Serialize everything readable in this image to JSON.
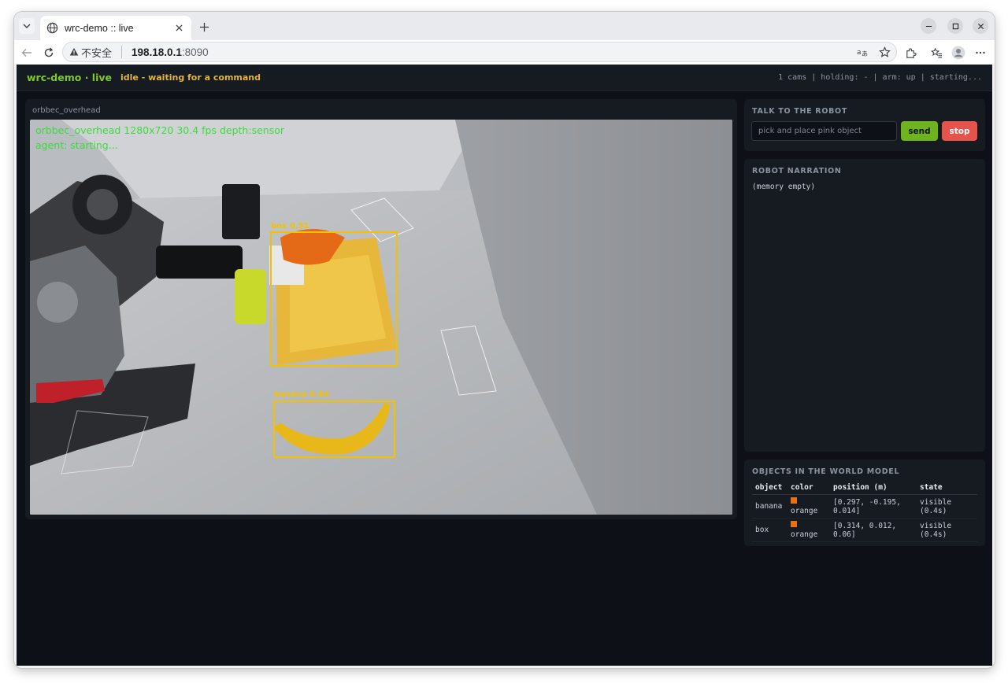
{
  "browser": {
    "tab_title": "wrc-demo :: live",
    "insecure_label": "不安全",
    "url_host": "198.18.0.1",
    "url_port": ":8090"
  },
  "header": {
    "brand": "wrc-demo · live",
    "status": "idle - waiting for a command",
    "meta": "1 cams | holding: - | arm: up | starting..."
  },
  "camera": {
    "name": "orbbec_overhead",
    "overlay_line1": "orbbec_overhead 1280x720 30.4 fps depth:sensor",
    "overlay_line2": "agent: starting...",
    "detections": [
      {
        "label": "box 0.51"
      },
      {
        "label": "banana 0.84"
      }
    ]
  },
  "talk": {
    "title": "TALK TO THE ROBOT",
    "placeholder": "pick and place pink object",
    "send_label": "send",
    "stop_label": "stop"
  },
  "narration": {
    "title": "ROBOT NARRATION",
    "text": "(memory empty)"
  },
  "objects": {
    "title": "OBJECTS IN THE WORLD MODEL",
    "headers": {
      "object": "object",
      "color": "color",
      "position": "position (m)",
      "state": "state"
    },
    "rows": [
      {
        "object": "banana",
        "color": "orange",
        "swatch": "#e8730c",
        "position": "[0.297, -0.195, 0.014]",
        "state": "visible (0.4s)"
      },
      {
        "object": "box",
        "color": "orange",
        "swatch": "#e8730c",
        "position": "[0.314, 0.012, 0.06]",
        "state": "visible (0.4s)"
      }
    ]
  },
  "colors": {
    "accent_green": "#7ec92f",
    "status_yellow": "#e3b341",
    "stop_red": "#e5534b",
    "detection_yellow": "#f2c200"
  }
}
